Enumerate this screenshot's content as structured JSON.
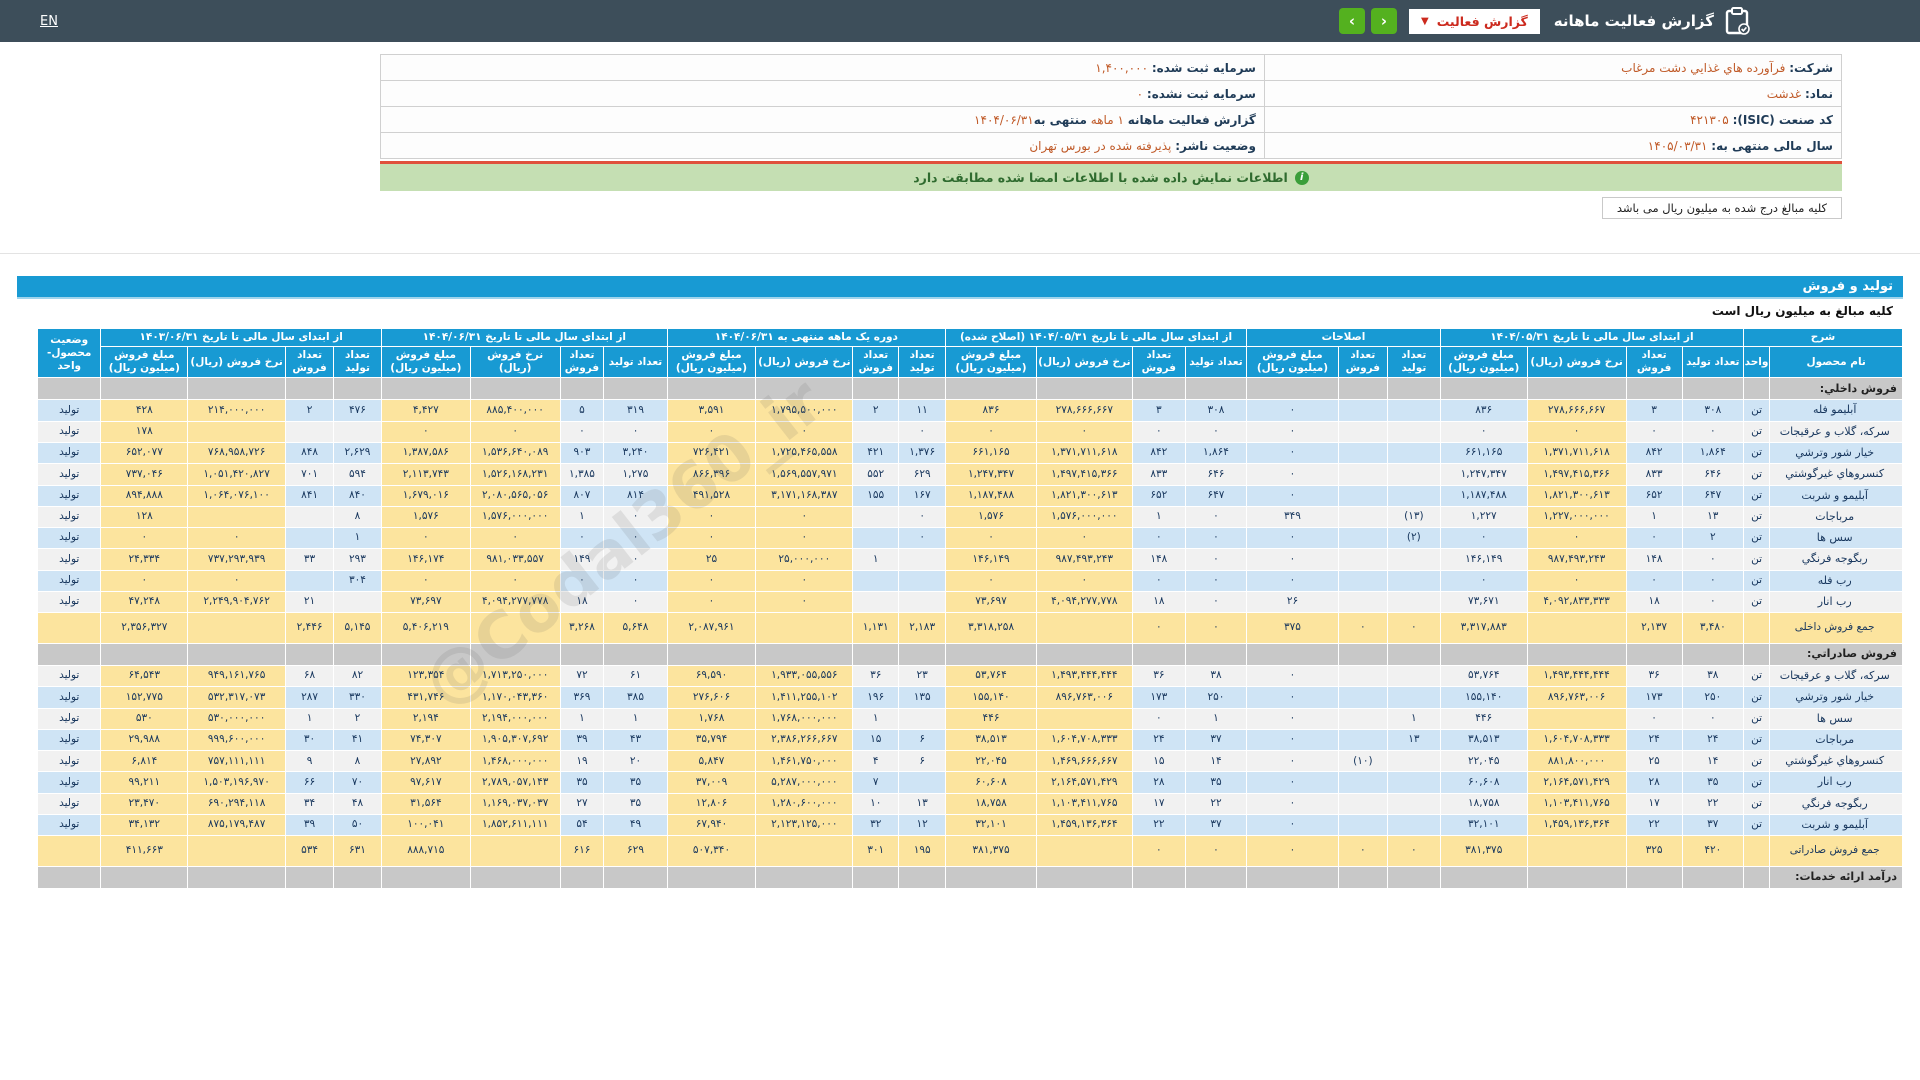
{
  "topbar": {
    "title": "گزارش فعالیت ماهانه",
    "dropdown_label": "گزارش فعالیت",
    "nav_prev": "‹",
    "nav_next": "›",
    "lang": "EN"
  },
  "info": {
    "right": [
      {
        "label": "شرکت:",
        "value": "فرآورده هاي غذايي دشت مرغاب"
      },
      {
        "label": "نماد:",
        "value": "غدشت"
      },
      {
        "label": "کد صنعت (ISIC):",
        "value": "۴۲۱۳۰۵"
      },
      {
        "label": "سال مالی منتهی به:",
        "value": "۱۴۰۵/۰۳/۳۱"
      }
    ],
    "left": [
      {
        "label": "سرمایه ثبت شده:",
        "value": "۱,۴۰۰,۰۰۰"
      },
      {
        "label": "سرمایه ثبت نشده:",
        "value": "۰"
      },
      {
        "label": "گزارش فعالیت ماهانه",
        "value": "۱ ماهه",
        "middle": "منتهی به",
        "date": "۱۴۰۴/۰۶/۳۱"
      },
      {
        "label": "وضعیت ناشر:",
        "value": "پذیرفته شده در بورس تهران"
      }
    ]
  },
  "notice": "اطلاعات نمایش داده شده با اطلاعات امضا شده مطابقت دارد",
  "unit_note_tab": "کلیه مبالغ درج شده به میلیون ریال می باشد",
  "section_title": "تولید و فروش",
  "section_subtitle": "کلیه مبالغ به میلیون ریال است",
  "watermark": "@Codal360_ir",
  "colors": {
    "accent_blue": "#189ad3",
    "button_green": "#54b11f",
    "alert_red": "#cc2a1e",
    "highlight_yellow": "#fce49e"
  },
  "table": {
    "col_desc": "شرح",
    "col_name": "نام محصول",
    "col_unit": "واحد",
    "col_status": "وضعیت محصول-واحد",
    "sub": {
      "qty_prod": "تعداد تولید",
      "qty_sale": "تعداد فروش",
      "rate": "نرخ فروش (ریال)",
      "amount": "مبلغ فروش (میلیون ریال)"
    },
    "groups": [
      {
        "label": "از ابتدای سال مالی تا تاریخ ۱۴۰۴/۰۵/۳۱",
        "cols": 4
      },
      {
        "label": "اصلاحات",
        "cols": 3
      },
      {
        "label": "از ابتدای سال مالی تا تاریخ ۱۴۰۴/۰۵/۳۱ (اصلاح شده)",
        "cols": 4
      },
      {
        "label": "دوره یک ماهه منتهی به ۱۴۰۴/۰۶/۳۱",
        "cols": 4
      },
      {
        "label": "از ابتدای سال مالی تا تاریخ ۱۴۰۴/۰۶/۳۱",
        "cols": 4
      },
      {
        "label": "از ابتدای سال مالی تا تاریخ ۱۴۰۳/۰۶/۳۱",
        "cols": 4
      }
    ],
    "rows": [
      {
        "type": "section",
        "name": "فروش داخلي:"
      },
      {
        "type": "data",
        "alt": true,
        "name": "آبليمو فله",
        "unit": "تن",
        "status": "تولید",
        "v": [
          "۳۰۸",
          "۳",
          "۲۷۸,۶۶۶,۶۶۷",
          "۸۳۶",
          "",
          "",
          "۰",
          "۳۰۸",
          "۳",
          "۲۷۸,۶۶۶,۶۶۷",
          "۸۳۶",
          "۱۱",
          "۲",
          "۱,۷۹۵,۵۰۰,۰۰۰",
          "۳,۵۹۱",
          "۳۱۹",
          "۵",
          "۸۸۵,۴۰۰,۰۰۰",
          "۴,۴۲۷",
          "۴۷۶",
          "۲",
          "۲۱۴,۰۰۰,۰۰۰",
          "۴۲۸"
        ]
      },
      {
        "type": "data",
        "alt": false,
        "name": "سرکه، گلاب و عرقيجات",
        "unit": "تن",
        "status": "تولید",
        "v": [
          "۰",
          "۰",
          "۰",
          "۰",
          "",
          "",
          "۰",
          "۰",
          "۰",
          "۰",
          "۰",
          "۰",
          "",
          "۰",
          "۰",
          "۰",
          "۰",
          "۰",
          "۰",
          "",
          "",
          "",
          "۱۷۸"
        ]
      },
      {
        "type": "data",
        "alt": true,
        "name": "خيار شور وترشي",
        "unit": "تن",
        "status": "تولید",
        "v": [
          "۱,۸۶۴",
          "۸۴۲",
          "۱,۳۷۱,۷۱۱,۶۱۸",
          "۶۶۱,۱۶۵",
          "",
          "",
          "۰",
          "۱,۸۶۴",
          "۸۴۲",
          "۱,۳۷۱,۷۱۱,۶۱۸",
          "۶۶۱,۱۶۵",
          "۱,۳۷۶",
          "۴۲۱",
          "۱,۷۲۵,۴۶۵,۵۵۸",
          "۷۲۶,۴۲۱",
          "۳,۲۴۰",
          "۹۰۳",
          "۱,۵۳۶,۶۴۰,۰۸۹",
          "۱,۳۸۷,۵۸۶",
          "۲,۶۲۹",
          "۸۴۸",
          "۷۶۸,۹۵۸,۷۲۶",
          "۶۵۲,۰۷۷"
        ]
      },
      {
        "type": "data",
        "alt": false,
        "name": "کنسروهاي غيرگوشتي",
        "unit": "تن",
        "status": "تولید",
        "v": [
          "۶۴۶",
          "۸۳۳",
          "۱,۴۹۷,۴۱۵,۳۶۶",
          "۱,۲۴۷,۳۴۷",
          "",
          "",
          "۰",
          "۶۴۶",
          "۸۳۳",
          "۱,۴۹۷,۴۱۵,۳۶۶",
          "۱,۲۴۷,۳۴۷",
          "۶۲۹",
          "۵۵۲",
          "۱,۵۶۹,۵۵۷,۹۷۱",
          "۸۶۶,۳۹۶",
          "۱,۲۷۵",
          "۱,۳۸۵",
          "۱,۵۲۶,۱۶۸,۲۳۱",
          "۲,۱۱۳,۷۴۳",
          "۵۹۴",
          "۷۰۱",
          "۱,۰۵۱,۴۲۰,۸۲۷",
          "۷۳۷,۰۴۶"
        ]
      },
      {
        "type": "data",
        "alt": true,
        "name": "آبليمو و شربت",
        "unit": "تن",
        "status": "تولید",
        "v": [
          "۶۴۷",
          "۶۵۲",
          "۱,۸۲۱,۳۰۰,۶۱۳",
          "۱,۱۸۷,۴۸۸",
          "",
          "",
          "۰",
          "۶۴۷",
          "۶۵۲",
          "۱,۸۲۱,۳۰۰,۶۱۳",
          "۱,۱۸۷,۴۸۸",
          "۱۶۷",
          "۱۵۵",
          "۳,۱۷۱,۱۶۸,۳۸۷",
          "۴۹۱,۵۲۸",
          "۸۱۴",
          "۸۰۷",
          "۲,۰۸۰,۵۶۵,۰۵۶",
          "۱,۶۷۹,۰۱۶",
          "۸۴۰",
          "۸۴۱",
          "۱,۰۶۴,۰۷۶,۱۰۰",
          "۸۹۴,۸۸۸"
        ]
      },
      {
        "type": "data",
        "alt": false,
        "name": "مرباجات",
        "unit": "تن",
        "status": "تولید",
        "v": [
          "۱۳",
          "۱",
          "۱,۲۲۷,۰۰۰,۰۰۰",
          "۱,۲۲۷",
          "(۱۳)",
          "",
          "۳۴۹",
          "۰",
          "۱",
          "۱,۵۷۶,۰۰۰,۰۰۰",
          "۱,۵۷۶",
          "۰",
          "",
          "۰",
          "۰",
          "۰",
          "۱",
          "۱,۵۷۶,۰۰۰,۰۰۰",
          "۱,۵۷۶",
          "۸",
          "",
          "",
          "۱۲۸"
        ]
      },
      {
        "type": "data",
        "alt": true,
        "name": "سس ها",
        "unit": "تن",
        "status": "تولید",
        "v": [
          "۲",
          "۰",
          "۰",
          "۰",
          "(۲)",
          "",
          "۰",
          "۰",
          "۰",
          "۰",
          "۰",
          "۰",
          "",
          "۰",
          "۰",
          "۰",
          "۰",
          "۰",
          "۰",
          "۱",
          "",
          "۰",
          "۰"
        ]
      },
      {
        "type": "data",
        "alt": false,
        "name": "ربگوجه فرنگي",
        "unit": "تن",
        "status": "تولید",
        "v": [
          "۰",
          "۱۴۸",
          "۹۸۷,۴۹۳,۲۴۳",
          "۱۴۶,۱۴۹",
          "",
          "",
          "۰",
          "۰",
          "۱۴۸",
          "۹۸۷,۴۹۳,۲۴۳",
          "۱۴۶,۱۴۹",
          "",
          "۱",
          "۲۵,۰۰۰,۰۰۰",
          "۲۵",
          "۰",
          "۱۴۹",
          "۹۸۱,۰۳۳,۵۵۷",
          "۱۴۶,۱۷۴",
          "۲۹۳",
          "۳۳",
          "۷۳۷,۲۹۳,۹۳۹",
          "۲۴,۳۳۴"
        ]
      },
      {
        "type": "data",
        "alt": true,
        "name": "رب فله",
        "unit": "تن",
        "status": "تولید",
        "v": [
          "۰",
          "۰",
          "۰",
          "۰",
          "",
          "",
          "۰",
          "۰",
          "۰",
          "۰",
          "۰",
          "",
          "",
          "۰",
          "۰",
          "۰",
          "۰",
          "۰",
          "۰",
          "۳۰۴",
          "",
          "۰",
          "۰"
        ]
      },
      {
        "type": "data",
        "alt": false,
        "name": "رب انار",
        "unit": "تن",
        "status": "تولید",
        "v": [
          "۰",
          "۱۸",
          "۴,۰۹۲,۸۳۳,۳۳۳",
          "۷۳,۶۷۱",
          "",
          "",
          "۲۶",
          "۰",
          "۱۸",
          "۴,۰۹۴,۲۷۷,۷۷۸",
          "۷۳,۶۹۷",
          "",
          "",
          "۰",
          "۰",
          "۰",
          "۱۸",
          "۴,۰۹۴,۲۷۷,۷۷۸",
          "۷۳,۶۹۷",
          "",
          "۲۱",
          "۲,۲۴۹,۹۰۴,۷۶۲",
          "۴۷,۲۴۸"
        ]
      },
      {
        "type": "total",
        "name": "جمع فروش داخلی",
        "unit": "",
        "status": "",
        "v": [
          "۳,۴۸۰",
          "۲,۱۳۷",
          "",
          "۳,۳۱۷,۸۸۳",
          "۰",
          "۰",
          "۳۷۵",
          "۰",
          "۰",
          "",
          "۳,۳۱۸,۲۵۸",
          "۲,۱۸۳",
          "۱,۱۳۱",
          "",
          "۲,۰۸۷,۹۶۱",
          "۵,۶۴۸",
          "۳,۲۶۸",
          "",
          "۵,۴۰۶,۲۱۹",
          "۵,۱۴۵",
          "۲,۴۴۶",
          "",
          "۲,۳۵۶,۳۲۷"
        ]
      },
      {
        "type": "section",
        "name": "فروش صادراتي:"
      },
      {
        "type": "data",
        "alt": false,
        "name": "سرکه، گلاب و عرقيجات",
        "unit": "تن",
        "status": "تولید",
        "v": [
          "۳۸",
          "۳۶",
          "۱,۴۹۳,۴۴۴,۴۴۴",
          "۵۳,۷۶۴",
          "",
          "",
          "۰",
          "۳۸",
          "۳۶",
          "۱,۴۹۳,۴۴۴,۴۴۴",
          "۵۳,۷۶۴",
          "۲۳",
          "۳۶",
          "۱,۹۳۳,۰۵۵,۵۵۶",
          "۶۹,۵۹۰",
          "۶۱",
          "۷۲",
          "۱,۷۱۳,۲۵۰,۰۰۰",
          "۱۲۳,۳۵۴",
          "۸۲",
          "۶۸",
          "۹۴۹,۱۶۱,۷۶۵",
          "۶۴,۵۴۳"
        ]
      },
      {
        "type": "data",
        "alt": true,
        "name": "خيار شور وترشي",
        "unit": "تن",
        "status": "تولید",
        "v": [
          "۲۵۰",
          "۱۷۳",
          "۸۹۶,۷۶۳,۰۰۶",
          "۱۵۵,۱۴۰",
          "",
          "",
          "۰",
          "۲۵۰",
          "۱۷۳",
          "۸۹۶,۷۶۳,۰۰۶",
          "۱۵۵,۱۴۰",
          "۱۳۵",
          "۱۹۶",
          "۱,۴۱۱,۲۵۵,۱۰۲",
          "۲۷۶,۶۰۶",
          "۳۸۵",
          "۳۶۹",
          "۱,۱۷۰,۰۴۳,۳۶۰",
          "۴۳۱,۷۴۶",
          "۳۳۰",
          "۲۸۷",
          "۵۳۲,۳۱۷,۰۷۳",
          "۱۵۲,۷۷۵"
        ]
      },
      {
        "type": "data",
        "alt": false,
        "name": "سس ها",
        "unit": "تن",
        "status": "تولید",
        "v": [
          "۰",
          "۰",
          "",
          "۴۴۶",
          "۱",
          "",
          "۰",
          "۱",
          "۰",
          "",
          "۴۴۶",
          "",
          "۱",
          "۱,۷۶۸,۰۰۰,۰۰۰",
          "۱,۷۶۸",
          "۱",
          "۱",
          "۲,۱۹۴,۰۰۰,۰۰۰",
          "۲,۱۹۴",
          "۲",
          "۱",
          "۵۳۰,۰۰۰,۰۰۰",
          "۵۳۰"
        ]
      },
      {
        "type": "data",
        "alt": true,
        "name": "مرباجات",
        "unit": "تن",
        "status": "تولید",
        "v": [
          "۲۴",
          "۲۴",
          "۱,۶۰۴,۷۰۸,۳۳۳",
          "۳۸,۵۱۳",
          "۱۳",
          "",
          "۰",
          "۳۷",
          "۲۴",
          "۱,۶۰۴,۷۰۸,۳۳۳",
          "۳۸,۵۱۳",
          "۶",
          "۱۵",
          "۲,۳۸۶,۲۶۶,۶۶۷",
          "۳۵,۷۹۴",
          "۴۳",
          "۳۹",
          "۱,۹۰۵,۳۰۷,۶۹۲",
          "۷۴,۳۰۷",
          "۴۱",
          "۳۰",
          "۹۹۹,۶۰۰,۰۰۰",
          "۲۹,۹۸۸"
        ]
      },
      {
        "type": "data",
        "alt": false,
        "name": "کنسروهاي غيرگوشتي",
        "unit": "تن",
        "status": "تولید",
        "v": [
          "۱۴",
          "۲۵",
          "۸۸۱,۸۰۰,۰۰۰",
          "۲۲,۰۴۵",
          "",
          "(۱۰)",
          "۰",
          "۱۴",
          "۱۵",
          "۱,۴۶۹,۶۶۶,۶۶۷",
          "۲۲,۰۴۵",
          "۶",
          "۴",
          "۱,۴۶۱,۷۵۰,۰۰۰",
          "۵,۸۴۷",
          "۲۰",
          "۱۹",
          "۱,۴۶۸,۰۰۰,۰۰۰",
          "۲۷,۸۹۲",
          "۸",
          "۹",
          "۷۵۷,۱۱۱,۱۱۱",
          "۶,۸۱۴"
        ]
      },
      {
        "type": "data",
        "alt": true,
        "name": "رب انار",
        "unit": "تن",
        "status": "تولید",
        "v": [
          "۳۵",
          "۲۸",
          "۲,۱۶۴,۵۷۱,۴۲۹",
          "۶۰,۶۰۸",
          "",
          "",
          "۰",
          "۳۵",
          "۲۸",
          "۲,۱۶۴,۵۷۱,۴۲۹",
          "۶۰,۶۰۸",
          "",
          "۷",
          "۵,۲۸۷,۰۰۰,۰۰۰",
          "۳۷,۰۰۹",
          "۳۵",
          "۳۵",
          "۲,۷۸۹,۰۵۷,۱۴۳",
          "۹۷,۶۱۷",
          "۷۰",
          "۶۶",
          "۱,۵۰۳,۱۹۶,۹۷۰",
          "۹۹,۲۱۱"
        ]
      },
      {
        "type": "data",
        "alt": false,
        "name": "ربگوجه فرنگي",
        "unit": "تن",
        "status": "تولید",
        "v": [
          "۲۲",
          "۱۷",
          "۱,۱۰۳,۴۱۱,۷۶۵",
          "۱۸,۷۵۸",
          "",
          "",
          "۰",
          "۲۲",
          "۱۷",
          "۱,۱۰۳,۴۱۱,۷۶۵",
          "۱۸,۷۵۸",
          "۱۳",
          "۱۰",
          "۱,۲۸۰,۶۰۰,۰۰۰",
          "۱۲,۸۰۶",
          "۳۵",
          "۲۷",
          "۱,۱۶۹,۰۳۷,۰۳۷",
          "۳۱,۵۶۴",
          "۴۸",
          "۳۴",
          "۶۹۰,۲۹۴,۱۱۸",
          "۲۳,۴۷۰"
        ]
      },
      {
        "type": "data",
        "alt": true,
        "name": "آبليمو و شربت",
        "unit": "تن",
        "status": "تولید",
        "v": [
          "۳۷",
          "۲۲",
          "۱,۴۵۹,۱۳۶,۳۶۴",
          "۳۲,۱۰۱",
          "",
          "",
          "۰",
          "۳۷",
          "۲۲",
          "۱,۴۵۹,۱۳۶,۳۶۴",
          "۳۲,۱۰۱",
          "۱۲",
          "۳۲",
          "۲,۱۲۳,۱۲۵,۰۰۰",
          "۶۷,۹۴۰",
          "۴۹",
          "۵۴",
          "۱,۸۵۲,۶۱۱,۱۱۱",
          "۱۰۰,۰۴۱",
          "۵۰",
          "۳۹",
          "۸۷۵,۱۷۹,۴۸۷",
          "۳۴,۱۳۲"
        ]
      },
      {
        "type": "total",
        "name": "جمع فروش صادراتی",
        "unit": "",
        "status": "",
        "v": [
          "۴۲۰",
          "۳۲۵",
          "",
          "۳۸۱,۳۷۵",
          "۰",
          "۰",
          "۰",
          "۰",
          "۰",
          "",
          "۳۸۱,۳۷۵",
          "۱۹۵",
          "۳۰۱",
          "",
          "۵۰۷,۳۴۰",
          "۶۲۹",
          "۶۱۶",
          "",
          "۸۸۸,۷۱۵",
          "۶۳۱",
          "۵۳۴",
          "",
          "۴۱۱,۶۶۳"
        ]
      },
      {
        "type": "section",
        "name": "درآمد ارائه خدمات:"
      }
    ]
  }
}
